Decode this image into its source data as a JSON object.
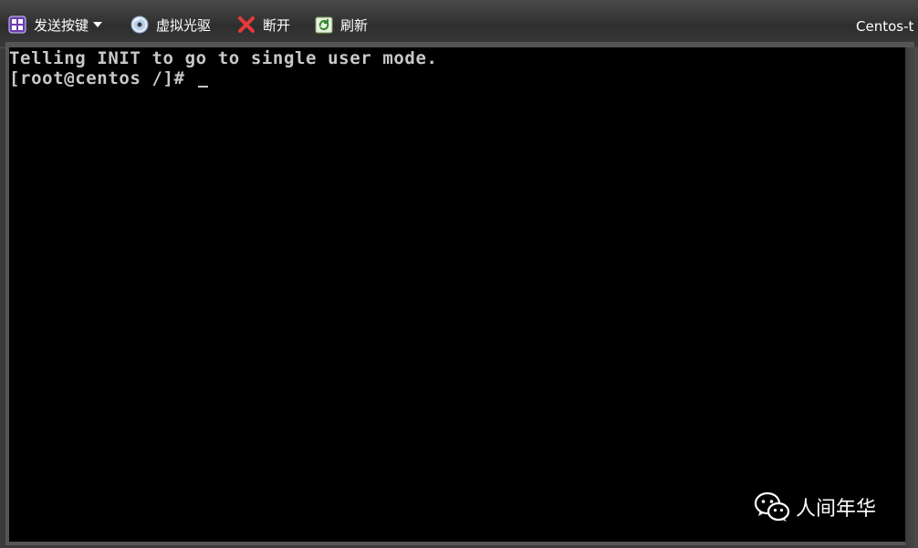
{
  "toolbar": {
    "send_keys_label": "发送按键",
    "virtual_cd_label": "虚拟光驱",
    "disconnect_label": "断开",
    "refresh_label": "刷新",
    "window_title": "Centos-t"
  },
  "console": {
    "lines": [
      "Telling INIT to go to single user mode.",
      "[root@centos /]# "
    ]
  },
  "watermark": {
    "text": "人间年华"
  },
  "colors": {
    "terminal_bg": "#000000",
    "terminal_fg": "#c8c8c8",
    "toolbar_text": "#ffffff"
  },
  "icons": {
    "send_keys": "keyboard-icon",
    "virtual_cd": "cd-icon",
    "disconnect": "close-icon",
    "refresh": "refresh-icon",
    "watermark": "wechat-icon"
  }
}
